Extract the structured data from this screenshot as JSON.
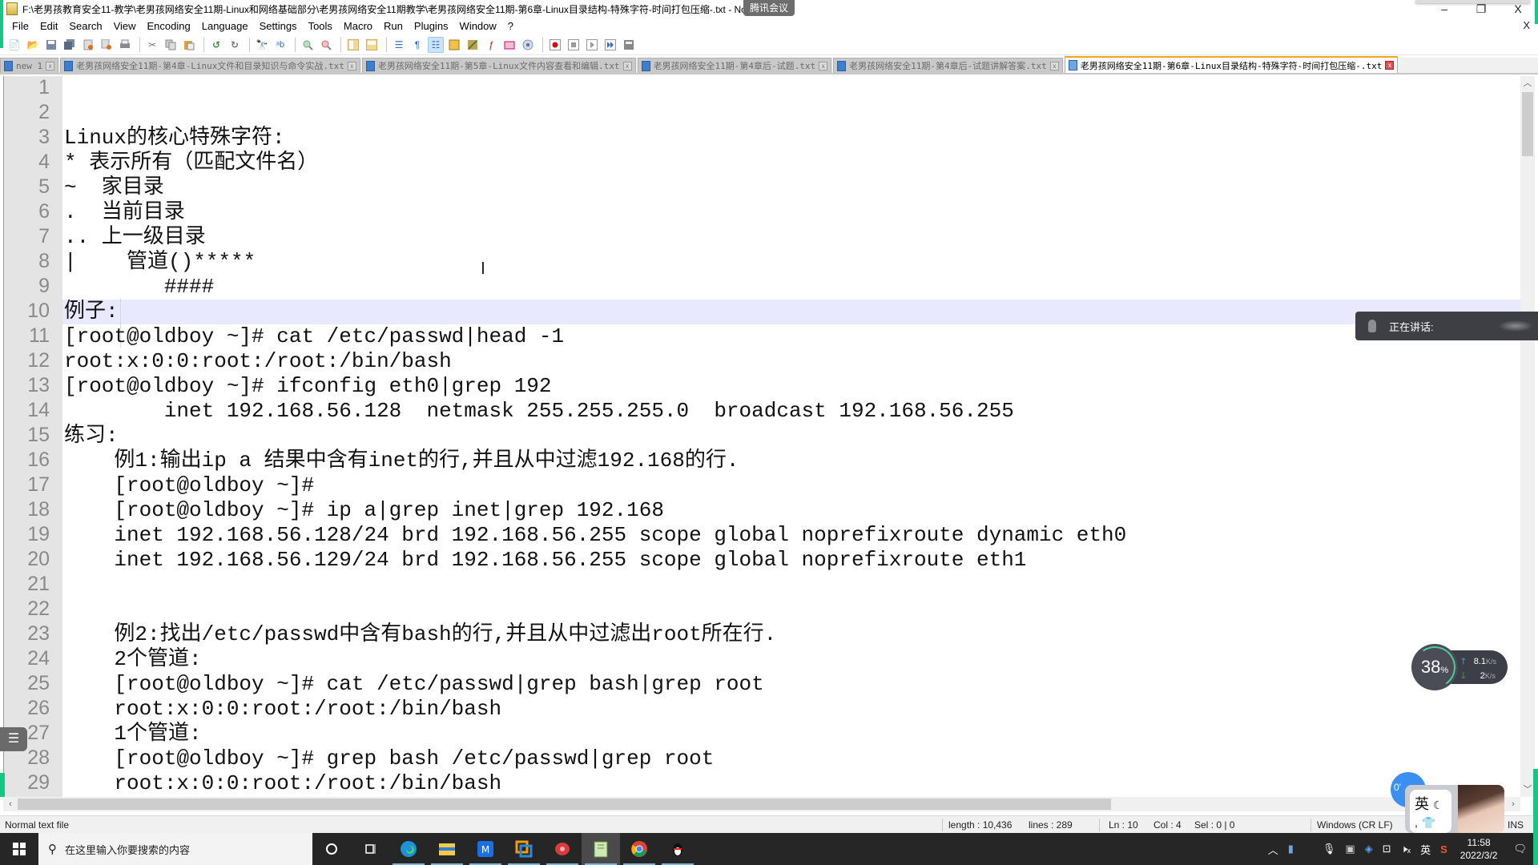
{
  "window": {
    "title": "F:\\老男孩教育安全11-教学\\老男孩网络安全11期-Linux和网络基础部分\\老男孩网络安全11期教学\\老男孩网络安全11期-第6章-Linux目录结构-特殊字符-时间打包压缩-.txt - Notepad++",
    "meeting_badge": "腾讯会议",
    "controls": {
      "minimize": "–",
      "restore": "❐",
      "close": "X"
    },
    "doc_close": "X"
  },
  "menubar": [
    "File",
    "Edit",
    "Search",
    "View",
    "Encoding",
    "Language",
    "Settings",
    "Tools",
    "Macro",
    "Run",
    "Plugins",
    "Window",
    "?"
  ],
  "toolbar": {
    "buttons": [
      "new",
      "open",
      "save",
      "save-all",
      "close",
      "close-all",
      "print",
      "cut",
      "copy",
      "paste",
      "undo",
      "redo",
      "find",
      "replace",
      "zoom-in",
      "zoom-out",
      "sync-vertical",
      "sync-horizontal",
      "word-wrap",
      "show-all-chars",
      "indent-guide",
      "udl",
      "doc-map",
      "function-list",
      "folder-as-workspace",
      "monitoring",
      "record-macro",
      "stop-record",
      "play-macro",
      "run-macro-multiple",
      "save-macro"
    ]
  },
  "tabs": [
    {
      "label": "new 1",
      "active": false
    },
    {
      "label": "老男孩网络安全11期-第4章-Linux文件和目录知识与命令实战.txt",
      "active": false
    },
    {
      "label": "老男孩网络安全11期-第5章-Linux文件内容查看和编辑.txt",
      "active": false
    },
    {
      "label": "老男孩网络安全11期-第4章后-试题.txt",
      "active": false
    },
    {
      "label": "老男孩网络安全11期-第4章后-试题讲解答案.txt",
      "active": false
    },
    {
      "label": "老男孩网络安全11期-第6章-Linux目录结构-特殊字符-时间打包压缩-.txt",
      "active": true
    }
  ],
  "editor": {
    "current_line": 10,
    "lines": [
      "",
      "",
      "Linux的核心特殊字符:",
      "* 表示所有（匹配文件名）",
      "~  家目录",
      ".  当前目录",
      ".. 上一级目录",
      "|    管道()*****",
      "        ####",
      "例子:",
      "[root@oldboy ~]# cat /etc/passwd|head -1",
      "root:x:0:0:root:/root:/bin/bash",
      "[root@oldboy ~]# ifconfig eth0|grep 192",
      "        inet 192.168.56.128  netmask 255.255.255.0  broadcast 192.168.56.255",
      "练习:",
      "    例1:输出ip a 结果中含有inet的行,并且从中过滤192.168的行.",
      "    [root@oldboy ~]#",
      "    [root@oldboy ~]# ip a|grep inet|grep 192.168",
      "    inet 192.168.56.128/24 brd 192.168.56.255 scope global noprefixroute dynamic eth0",
      "    inet 192.168.56.129/24 brd 192.168.56.255 scope global noprefixroute eth1",
      "",
      "",
      "    例2:找出/etc/passwd中含有bash的行,并且从中过滤出root所在行.",
      "    2个管道:",
      "    [root@oldboy ~]# cat /etc/passwd|grep bash|grep root",
      "    root:x:0:0:root:/root:/bin/bash",
      "    1个管道:",
      "    [root@oldboy ~]# grep bash /etc/passwd|grep root",
      "    root:x:0:0:root:/root:/bin/bash"
    ]
  },
  "statusbar": {
    "file_type": "Normal text file",
    "length": "length : 10,436",
    "lines": "lines : 289",
    "ln": "Ln : 10",
    "col": "Col : 4",
    "sel": "Sel : 0 | 0",
    "eol": "Windows (CR LF)",
    "mode": "INS"
  },
  "taskbar": {
    "search_placeholder": "在这里输入你要搜索的内容",
    "apps": [
      "cortana",
      "task-view",
      "edge",
      "file-explorer",
      "app-m",
      "vmware",
      "xshell",
      "notepad-plus-plus",
      "chrome",
      "qq"
    ],
    "active_app": "notepad-plus-plus",
    "tray": {
      "ime": "英",
      "time": "11:58",
      "date": "2022/3/2"
    }
  },
  "overlays": {
    "speaking_label": "正在讲话:",
    "net_widget": {
      "cpu_percent": 38,
      "upload": "8.1",
      "upload_unit": "K/s",
      "download": "2",
      "download_unit": "K/s"
    },
    "ime_label": "英",
    "bubble_text": "0'"
  }
}
